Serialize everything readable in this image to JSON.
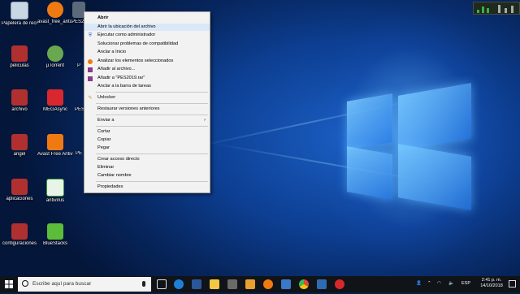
{
  "desktop": {
    "icons": [
      {
        "label": "Papelera de reciclaje",
        "icon": "recycle-bin-icon",
        "color": "#c9d6e3"
      },
      {
        "label": "avast_free_anti...",
        "icon": "avast-installer-icon",
        "color": "#f07a12"
      },
      {
        "label": "PES2...",
        "icon": "pes-file-icon",
        "color": "#5a6a7a"
      },
      {
        "label": "peliculas",
        "icon": "archive-icon",
        "color": "#b03030"
      },
      {
        "label": "µTorrent",
        "icon": "utorrent-icon",
        "color": "#6aa84f"
      },
      {
        "label": "archivo",
        "icon": "archive-icon",
        "color": "#b03030"
      },
      {
        "label": "MEGAsync",
        "icon": "megasync-icon",
        "color": "#d9272e"
      },
      {
        "label": "angel",
        "icon": "archive-icon",
        "color": "#b03030"
      },
      {
        "label": "Avast Free Antivirus",
        "icon": "avast-icon",
        "color": "#f07a12"
      },
      {
        "label": "aplicaciones",
        "icon": "archive-icon",
        "color": "#b03030"
      },
      {
        "label": "antivirus",
        "icon": "antivirus-icon",
        "color": "#3a9a3a"
      },
      {
        "label": "configuraciones",
        "icon": "archive-icon",
        "color": "#b03030"
      },
      {
        "label": "BlueStacks",
        "icon": "bluestacks-icon",
        "color": "#5bbd3a"
      }
    ],
    "partial_labels": [
      "P",
      "PES",
      "PE"
    ]
  },
  "context_menu": {
    "items": [
      {
        "label": "Abrir",
        "bold": true,
        "icon": ""
      },
      {
        "label": "Abrir la ubicación del archivo",
        "icon": "",
        "highlight": true
      },
      {
        "label": "Ejecutar como administrador",
        "icon": "shield-icon"
      },
      {
        "label": "Solucionar problemas de compatibilidad",
        "icon": ""
      },
      {
        "label": "Anclar a Inicio",
        "icon": ""
      },
      {
        "label": "Analizar los elementos seleccionados",
        "icon": "avast-icon"
      },
      {
        "label": "Añadir al archivo...",
        "icon": "winrar-icon"
      },
      {
        "label": "Añadir a \"PES2019.rar\"",
        "icon": "winrar-icon"
      },
      {
        "label": "Anclar a la barra de tareas",
        "icon": ""
      },
      {
        "label": "Unlocker",
        "icon": "unlocker-icon"
      },
      {
        "label": "Restaurar versiones anteriores",
        "icon": ""
      },
      {
        "label": "Enviar a",
        "icon": "",
        "submenu": true
      },
      {
        "label": "Cortar",
        "icon": ""
      },
      {
        "label": "Copiar",
        "icon": ""
      },
      {
        "label": "Pegar",
        "icon": ""
      },
      {
        "label": "Crear acceso directo",
        "icon": ""
      },
      {
        "label": "Eliminar",
        "icon": ""
      },
      {
        "label": "Cambiar nombre",
        "icon": ""
      },
      {
        "label": "Propiedades",
        "icon": ""
      }
    ]
  },
  "taskbar": {
    "search_placeholder": "Escribe aquí para buscar",
    "language": "ESP",
    "time": "2:41 p. m.",
    "date": "14/10/2018",
    "pinned": [
      {
        "icon": "task-view-icon",
        "color": "#dddddd"
      },
      {
        "icon": "edge-icon",
        "color": "#1e7fd8"
      },
      {
        "icon": "word-icon",
        "color": "#2b579a"
      },
      {
        "icon": "file-explorer-icon",
        "color": "#f2c744"
      },
      {
        "icon": "store-icon",
        "color": "#4a4a4a"
      },
      {
        "icon": "paint-icon",
        "color": "#e8a030"
      },
      {
        "icon": "avast-icon",
        "color": "#f07a12"
      },
      {
        "icon": "mail-icon",
        "color": "#3a78c8"
      },
      {
        "icon": "chrome-icon",
        "color": "#dd4b39"
      },
      {
        "icon": "photos-icon",
        "color": "#2d6cb5"
      },
      {
        "icon": "record-icon",
        "color": "#d9272e"
      }
    ]
  }
}
